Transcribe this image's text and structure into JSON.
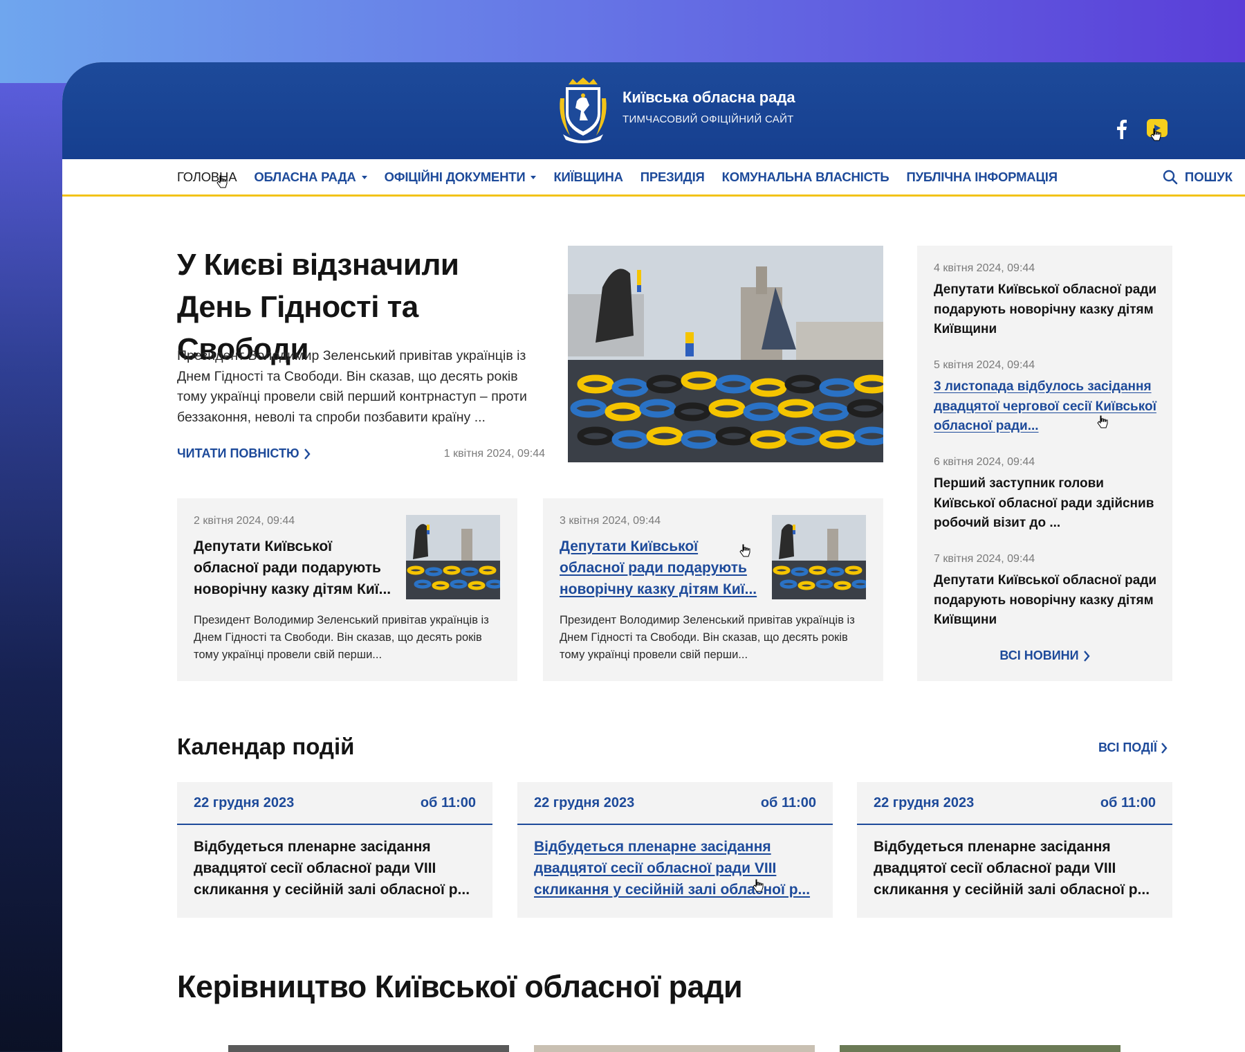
{
  "header": {
    "title": "Київська обласна рада",
    "subtitle": "ТИМЧАСОВИЙ ОФІЦІЙНИЙ САЙТ",
    "accent_color": "#1d4a9a",
    "highlight_color": "#f2c318",
    "social": [
      {
        "icon": "facebook-icon"
      },
      {
        "icon": "youtube-icon"
      }
    ]
  },
  "nav": {
    "items": [
      {
        "label": "ГОЛОВНА",
        "active": true
      },
      {
        "label": "ОБЛАСНА РАДА",
        "dropdown": true
      },
      {
        "label": "ОФІЦІЙНІ ДОКУМЕНТИ",
        "dropdown": true
      },
      {
        "label": "КИЇВЩИНА"
      },
      {
        "label": "ПРЕЗИДІЯ"
      },
      {
        "label": "КОМУНАЛЬНА ВЛАСНІСТЬ"
      },
      {
        "label": "ПУБЛІЧНА ІНФОРМАЦІЯ"
      }
    ],
    "search_label": "ПОШУК"
  },
  "hero": {
    "title": "У Києві відзначили День Гідності та Свободи",
    "text": "Президент Володимир Зеленський привітав українців із Днем Гідності та Свободи. Він сказав, що десять років тому українці провели свій перший контрнаступ – проти беззаконня, неволі та спроби позбавити країну ...",
    "read_more": "ЧИТАТИ ПОВНІСТЮ",
    "date": "1 квітня 2024, 09:44"
  },
  "cards": [
    {
      "date": "2 квітня 2024, 09:44",
      "title": "Депутати Київської обласної ради подарують новорічну казку дітям Киї...",
      "text": "Президент Володимир Зеленський привітав українців із Днем Гідності та Свободи. Він сказав, що десять років тому українці провели свій перши..."
    },
    {
      "date": "3 квітня 2024, 09:44",
      "title": "Депутати Київської обласної ради подарують новорічну казку дітям Киї...",
      "text": "Президент Володимир Зеленський привітав українців із Днем Гідності та Свободи. Він сказав, що десять років тому українці провели свій перши..."
    }
  ],
  "sidebar": {
    "items": [
      {
        "date": "4 квітня 2024, 09:44",
        "title": "Депутати Київської обласної ради подарують новорічну казку дітям Київщини"
      },
      {
        "date": "5 квітня 2024, 09:44",
        "title": "3 листопада відбулось засідання двадцятої чергової сесії Київської обласної ради..."
      },
      {
        "date": "6 квітня 2024, 09:44",
        "title": "Перший заступник голови Київської обласної ради здійснив робочий візит до ..."
      },
      {
        "date": "7 квітня 2024, 09:44",
        "title": "Депутати Київської обласної ради подарують новорічну казку дітям Київщини"
      }
    ],
    "all_news": "ВСІ НОВИНИ"
  },
  "calendar": {
    "title": "Календар подій",
    "all_events": "ВСІ ПОДІЇ",
    "events": [
      {
        "date": "22 грудня 2023",
        "time": "об 11:00",
        "title": "Відбудеться пленарне засідання двадцятої сесії обласної ради VIII скликання у сесійній залі обласної р..."
      },
      {
        "date": "22 грудня 2023",
        "time": "об 11:00",
        "title": "Відбудеться пленарне засідання двадцятої сесії обласної ради VIII скликання у сесійній залі обласної р..."
      },
      {
        "date": "22 грудня 2023",
        "time": "об 11:00",
        "title": "Відбудеться пленарне засідання двадцятої сесії обласної ради VIII скликання у сесійній залі обласної р..."
      }
    ]
  },
  "leadership": {
    "title": "Керівництво Київської обласної ради"
  }
}
